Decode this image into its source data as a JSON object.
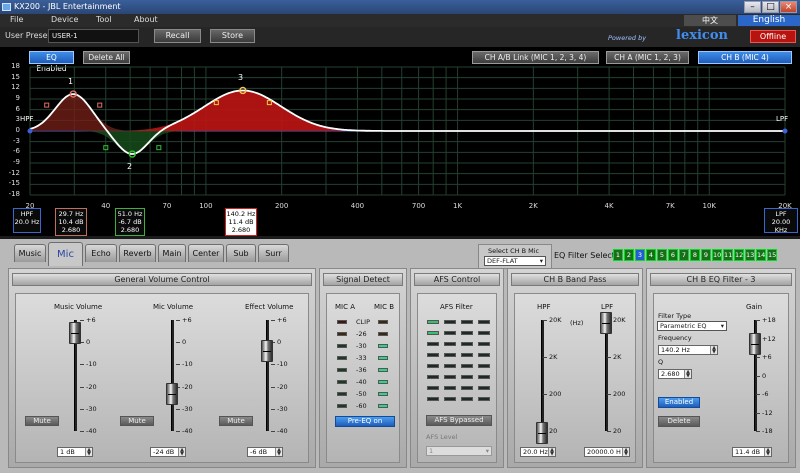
{
  "window": {
    "title": "KX200 - JBL Entertainment"
  },
  "menu": [
    "File",
    "Device",
    "Tool",
    "About"
  ],
  "lang": {
    "zh": "中文",
    "en": "English"
  },
  "brand": {
    "powered": "Powered by",
    "name": "lexicon"
  },
  "status": "Offline",
  "preset": {
    "label": "User Preset",
    "value": "USER-1",
    "recall": "Recall",
    "store": "Store"
  },
  "eq": {
    "enabled": "EQ Enabled",
    "delete_all": "Delete All",
    "link": "CH A/B Link (MIC 1, 2, 3, 4)",
    "cha": "CH A (MIC 1, 2, 3)",
    "chb": "CH B (MIC 4)",
    "y_labels": [
      "18",
      "15",
      "12",
      "9",
      "6",
      "3",
      "0",
      "-3",
      "-6",
      "-9",
      "-12",
      "-15",
      "-18"
    ],
    "x_labels": [
      "20",
      "40",
      "70",
      "100",
      "200",
      "400",
      "700",
      "1K",
      "2K",
      "4K",
      "7K",
      "10K",
      "20K"
    ],
    "hpf_label": "HPF",
    "lpf_label": "LPF",
    "points": [
      "1",
      "2",
      "3"
    ],
    "hpf": {
      "name": "HPF",
      "value": "20.0 Hz"
    },
    "band1": {
      "freq": "29.7 Hz",
      "gain": "10.4 dB",
      "q": "2.680"
    },
    "band2": {
      "freq": "51.0 Hz",
      "gain": "-6.7 dB",
      "q": "2.680"
    },
    "band3": {
      "freq": "140.2 Hz",
      "gain": "11.4 dB",
      "q": "2.680"
    },
    "lpf": {
      "name": "LPF",
      "value": "20.00 KHz"
    }
  },
  "tabs": [
    "Music",
    "Mic",
    "Echo",
    "Reverb",
    "Main",
    "Center",
    "Sub",
    "Surr"
  ],
  "select_mic": {
    "label": "Select CH B Mic",
    "value": "DEF-FLAT"
  },
  "filter_select": {
    "label": "EQ Filter Select",
    "items": [
      "1",
      "2",
      "3",
      "4",
      "5",
      "6",
      "7",
      "8",
      "9",
      "10",
      "11",
      "12",
      "13",
      "14",
      "15"
    ]
  },
  "gvc": {
    "title": "General Volume Control",
    "music": "Music Volume",
    "mic": "Mic Volume",
    "effect": "Effect Volume",
    "scale": [
      "+6",
      "0",
      "-10",
      "-20",
      "-30",
      "-40"
    ],
    "mute": "Mute",
    "music_val": "1 dB",
    "mic_val": "-24 dB",
    "effect_val": "-6 dB"
  },
  "signal": {
    "title": "Signal Detect",
    "mica": "MIC A",
    "micb": "MIC B",
    "levels": [
      "CLIP",
      "-26",
      "-30",
      "-33",
      "-36",
      "-40",
      "-50",
      "-60"
    ],
    "pre_eq": "Pre-EQ on"
  },
  "afs": {
    "title": "AFS Control",
    "filter": "AFS Filter",
    "bypass": "AFS Bypassed",
    "level_label": "AFS Level",
    "level": "1"
  },
  "bandpass": {
    "title": "CH B Band Pass",
    "hpf": "HPF",
    "lpf": "LPF",
    "unit": "(Hz)",
    "scale": [
      "20K",
      "2K",
      "200",
      "20"
    ],
    "hpf_val": "20.0 Hz",
    "lpf_val": "20000.0 H"
  },
  "eqfilter": {
    "title": "CH B EQ Filter - 3",
    "type_label": "Filter Type",
    "type": "Parametric EQ",
    "freq_label": "Frequency",
    "freq": "140.2 Hz",
    "q_label": "Q",
    "q": "2.680",
    "enabled": "Enabled",
    "delete": "Delete",
    "gain": "Gain",
    "scale": [
      "+18",
      "+12",
      "+6",
      "0",
      "-6",
      "-12",
      "-18"
    ],
    "gain_val": "11.4 dB"
  }
}
